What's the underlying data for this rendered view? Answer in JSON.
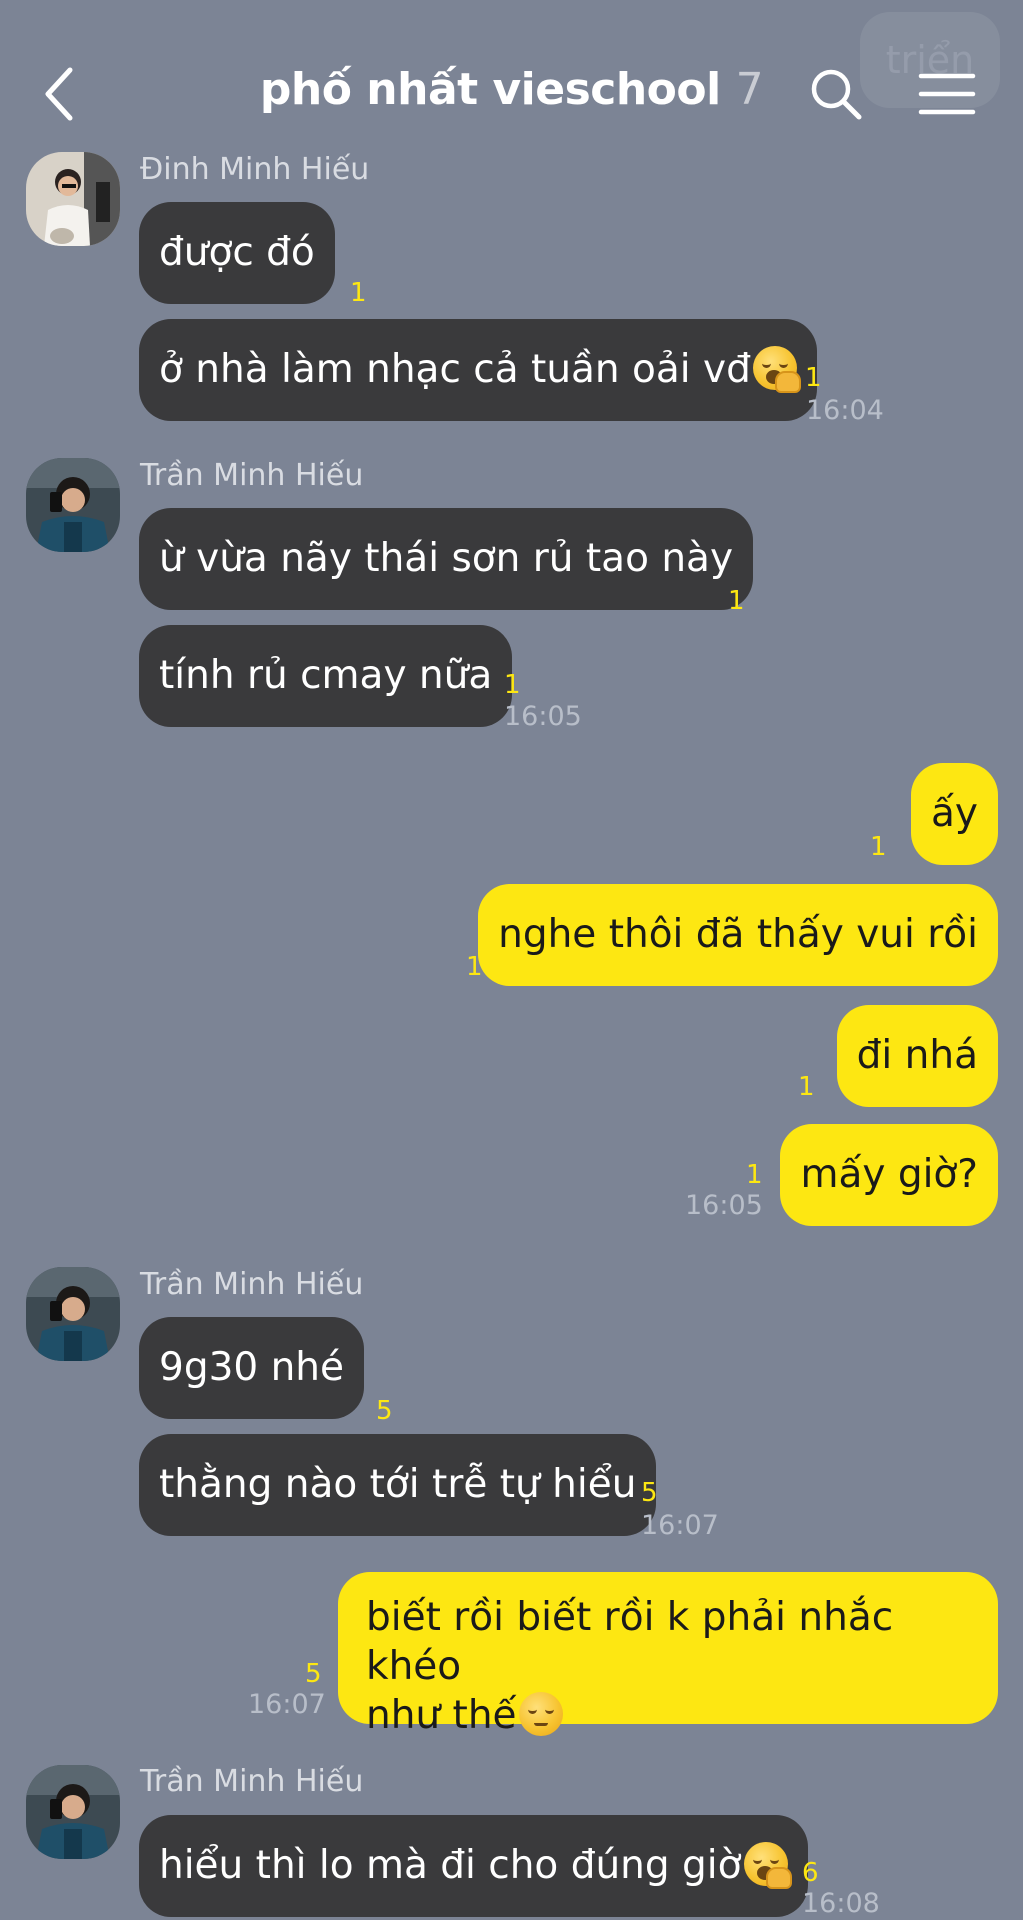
{
  "header": {
    "title": "phố nhất vieschool",
    "member_count": "7",
    "back_icon": "chevron-left-icon",
    "search_icon": "search-icon",
    "menu_icon": "hamburger-menu-icon"
  },
  "ghost": {
    "text": "triển"
  },
  "colors": {
    "background": "#7c8495",
    "incoming_bubble": "#3a3a3c",
    "outgoing_bubble": "#fde712",
    "unread_count": "#fde712"
  },
  "messages": {
    "g1": {
      "sender": "Đinh Minh Hiếu",
      "m1": {
        "text": "được đó",
        "unread": "1"
      },
      "m2": {
        "text": "ở nhà làm nhạc cả tuần oải vđ",
        "emoji": "yawning-face",
        "unread": "1",
        "time": "16:04"
      }
    },
    "g2": {
      "sender": "Trần Minh Hiếu",
      "m1": {
        "text": "ừ vừa nãy thái sơn rủ tao này",
        "unread": "1"
      },
      "m2": {
        "text": "tính rủ cmay nữa",
        "unread": "1",
        "time": "16:05"
      }
    },
    "out1": {
      "m1": {
        "text": "ấy",
        "unread": "1"
      },
      "m2": {
        "text": "nghe thôi đã thấy vui rồi",
        "unread": "1"
      },
      "m3": {
        "text": "đi nhá",
        "unread": "1"
      },
      "m4": {
        "text": "mấy giờ?",
        "unread": "1",
        "time": "16:05"
      }
    },
    "g3": {
      "sender": "Trần Minh Hiếu",
      "m1": {
        "text": "9g30 nhé",
        "unread": "5"
      },
      "m2": {
        "text": "thằng nào tới trễ tự hiểu",
        "unread": "5",
        "time": "16:07"
      }
    },
    "out2": {
      "m1": {
        "line1": "biết rồi biết rồi k phải nhắc khéo",
        "line2": "như thế",
        "emoji": "unamused-face",
        "unread": "5",
        "time": "16:07"
      }
    },
    "g4": {
      "sender": "Trần Minh Hiếu",
      "m1": {
        "text": "hiểu thì lo mà đi cho đúng giờ",
        "emoji": "yawning-face",
        "unread": "6",
        "time": "16:08"
      }
    }
  }
}
